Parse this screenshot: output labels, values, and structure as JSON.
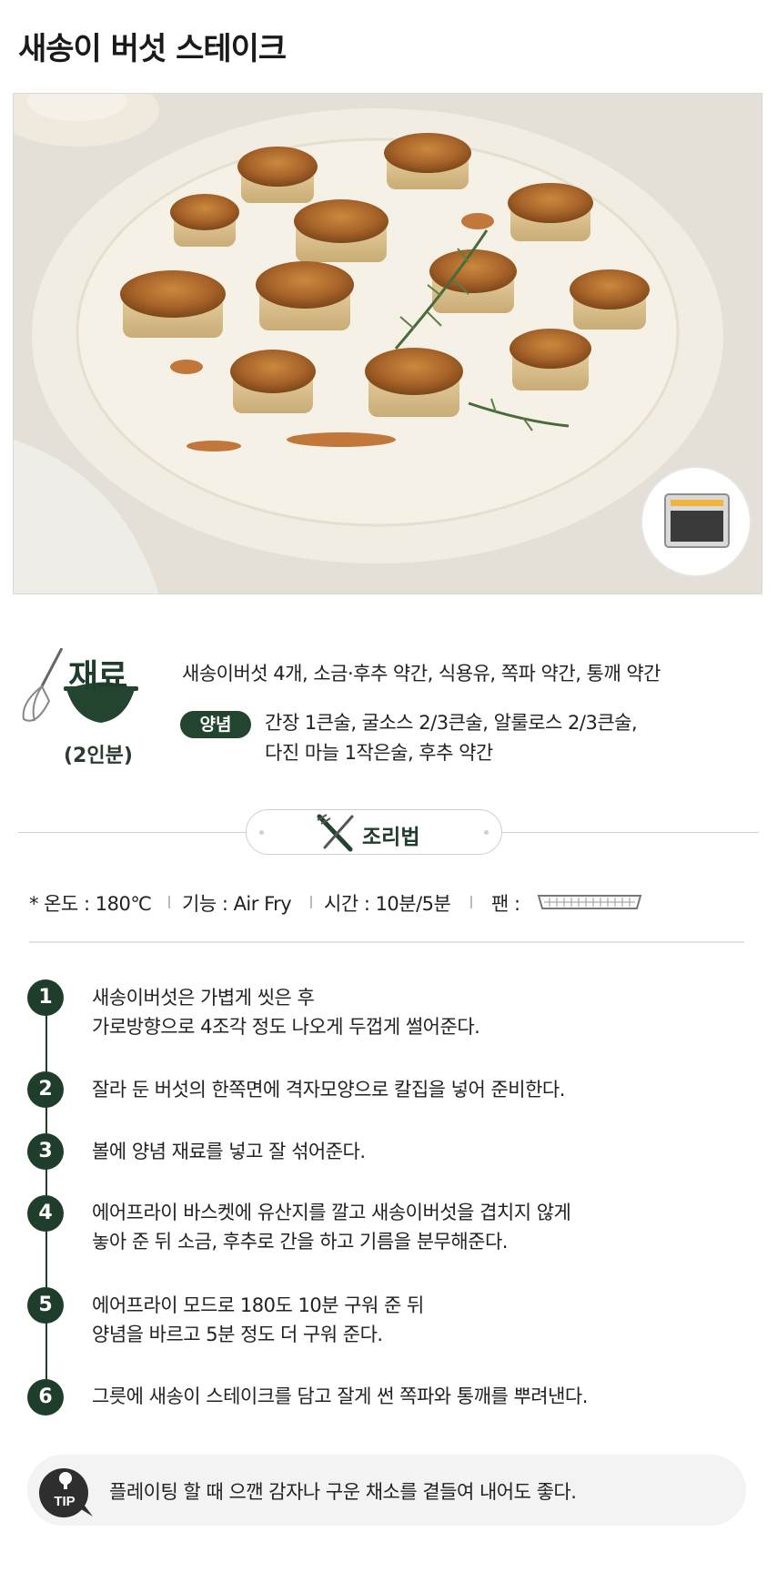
{
  "page": {
    "title": "새송이 버섯 스테이크"
  },
  "ingredients": {
    "label": "재료",
    "servings": "(2인분)",
    "main": "새송이버섯 4개, 소금·후추 약간, 식용유, 쪽파 약간, 통깨 약간",
    "sauce_label": "양념",
    "sauce_lines": [
      "간장 1큰술, 굴소스 2/3큰술, 알룰로스 2/3큰술,",
      "다진 마늘 1작은술, 후추 약간"
    ]
  },
  "recipe": {
    "label": "조리법"
  },
  "settings": {
    "temp": "* 온도 : 180℃",
    "function": "기능 : Air Fry",
    "time": "시간 : 10분/5분",
    "pan": "팬 :",
    "pan_icon": "tray-rack-icon"
  },
  "steps": [
    {
      "num": "1",
      "lines": [
        "새송이버섯은 가볍게 씻은 후",
        "가로방향으로 4조각 정도 나오게 두껍게 썰어준다."
      ]
    },
    {
      "num": "2",
      "lines": [
        "잘라 둔 버섯의 한쪽면에 격자모양으로 칼집을 넣어 준비한다."
      ]
    },
    {
      "num": "3",
      "lines": [
        "볼에 양념 재료를 넣고 잘 섞어준다."
      ]
    },
    {
      "num": "4",
      "lines": [
        "에어프라이 바스켓에 유산지를 깔고 새송이버섯을 겹치지 않게",
        "놓아 준 뒤 소금, 후추로 간을 하고 기름을 분무해준다."
      ]
    },
    {
      "num": "5",
      "lines": [
        "에어프라이 모드로 180도 10분 구워 준 뒤",
        "양념을 바르고 5분 정도 더 구워 준다."
      ]
    },
    {
      "num": "6",
      "lines": [
        "그릇에 새송이 스테이크를 담고 잘게 썬 쪽파와 통깨를 뿌려낸다."
      ]
    }
  ],
  "tip": {
    "badge": "TIP",
    "text": "플레이팅 할 때 으깬 감자나 구운 채소를 곁들여 내어도 좋다."
  },
  "colors": {
    "accent": "#1f3d2b",
    "tip_bg": "#f3f3f3"
  }
}
